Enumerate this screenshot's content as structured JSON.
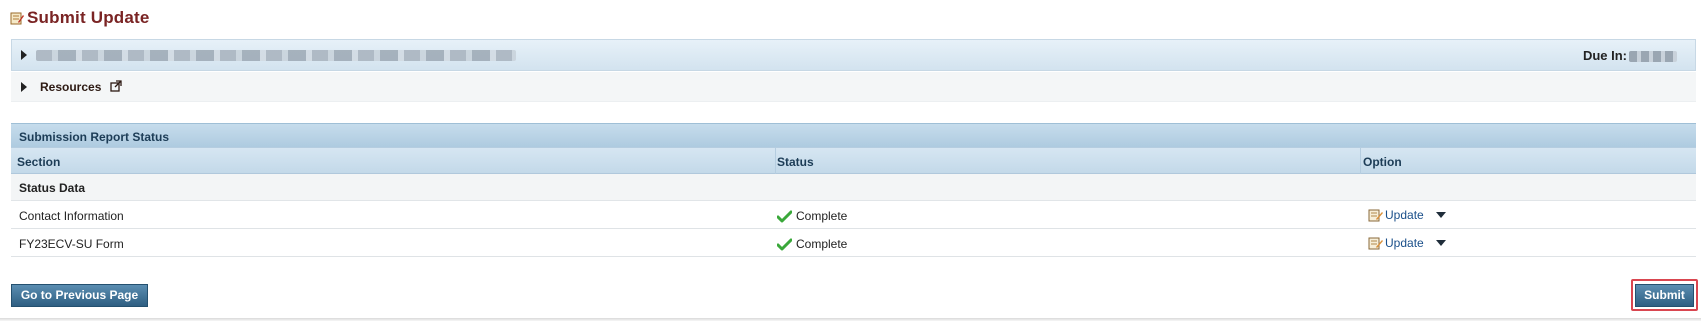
{
  "page": {
    "title": "Submit Update"
  },
  "info_panel": {
    "due_label": "Due In:"
  },
  "resources": {
    "label": "Resources"
  },
  "table": {
    "title": "Submission Report Status",
    "columns": [
      "Section",
      "Status",
      "Option"
    ],
    "group_label": "Status Data",
    "rows": [
      {
        "section": "Contact Information",
        "status": "Complete",
        "option": "Update"
      },
      {
        "section": "FY23ECV-SU Form",
        "status": "Complete",
        "option": "Update"
      }
    ]
  },
  "buttons": {
    "previous": "Go to Previous Page",
    "submit": "Submit"
  },
  "colors": {
    "title": "#7a2424",
    "button": "#2f5f82",
    "highlight": "#d94650",
    "check": "#3aa83a"
  },
  "icons": [
    "edit-doc-icon",
    "caret-right-icon",
    "external-link-icon",
    "check-icon",
    "chevron-down-icon"
  ]
}
